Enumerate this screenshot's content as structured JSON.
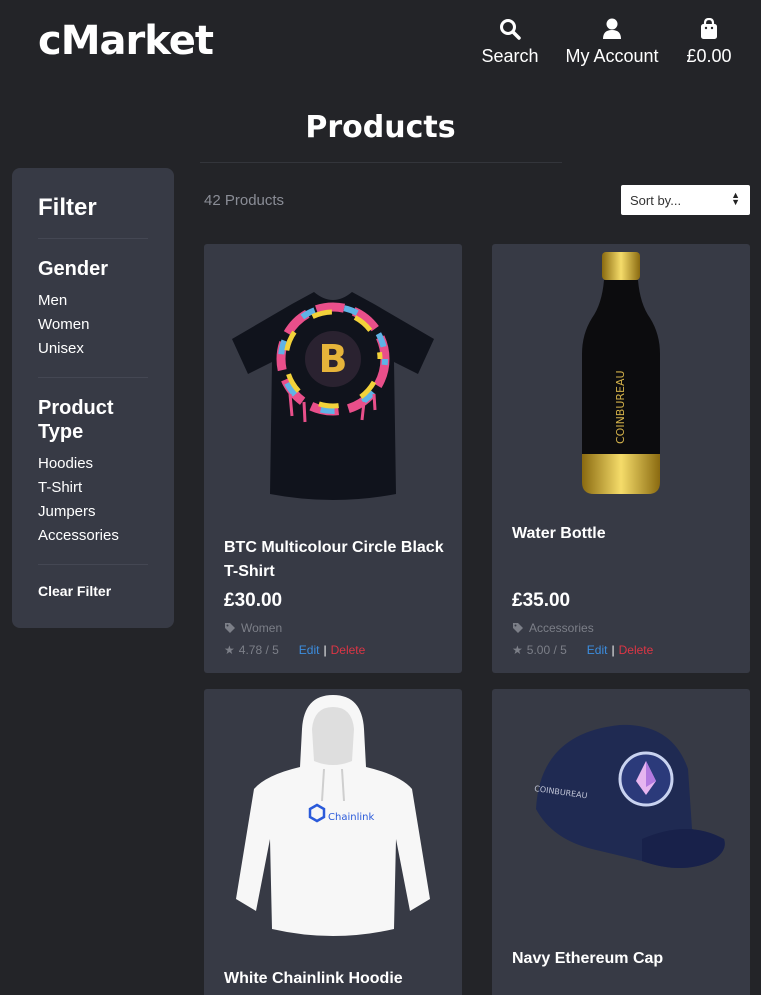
{
  "header": {
    "logo": "cMarket",
    "nav": {
      "search_label": "Search",
      "account_label": "My Account",
      "cart_label": "£0.00"
    }
  },
  "page_title": "Products",
  "filter": {
    "title": "Filter",
    "gender": {
      "heading": "Gender",
      "items": [
        "Men",
        "Women",
        "Unisex"
      ]
    },
    "product_type": {
      "heading": "Product Type",
      "items": [
        "Hoodies",
        "T-Shirt",
        "Jumpers",
        "Accessories"
      ]
    },
    "clear_label": "Clear Filter"
  },
  "toolbar": {
    "count": "42 Products",
    "sort_placeholder": "Sort by..."
  },
  "products": [
    {
      "name": "BTC Multicolour Circle Black T-Shirt",
      "price": "£30.00",
      "tag": "Women",
      "rating": "4.78 / 5",
      "edit_label": "Edit",
      "separator": "|",
      "delete_label": "Delete"
    },
    {
      "name": "Water Bottle",
      "price": "£35.00",
      "tag": "Accessories",
      "rating": "5.00 / 5",
      "edit_label": "Edit",
      "separator": "|",
      "delete_label": "Delete",
      "image_text": "COINBUREAU"
    },
    {
      "name": "White Chainlink Hoodie",
      "image_text": "Chainlink"
    },
    {
      "name": "Navy Ethereum Cap",
      "image_text": "COINBUREAU"
    }
  ],
  "colors": {
    "background": "#232428",
    "card": "#373a45",
    "edit_link": "#3c8dde",
    "delete_link": "#dc3545",
    "muted_text": "#7c7f88"
  }
}
